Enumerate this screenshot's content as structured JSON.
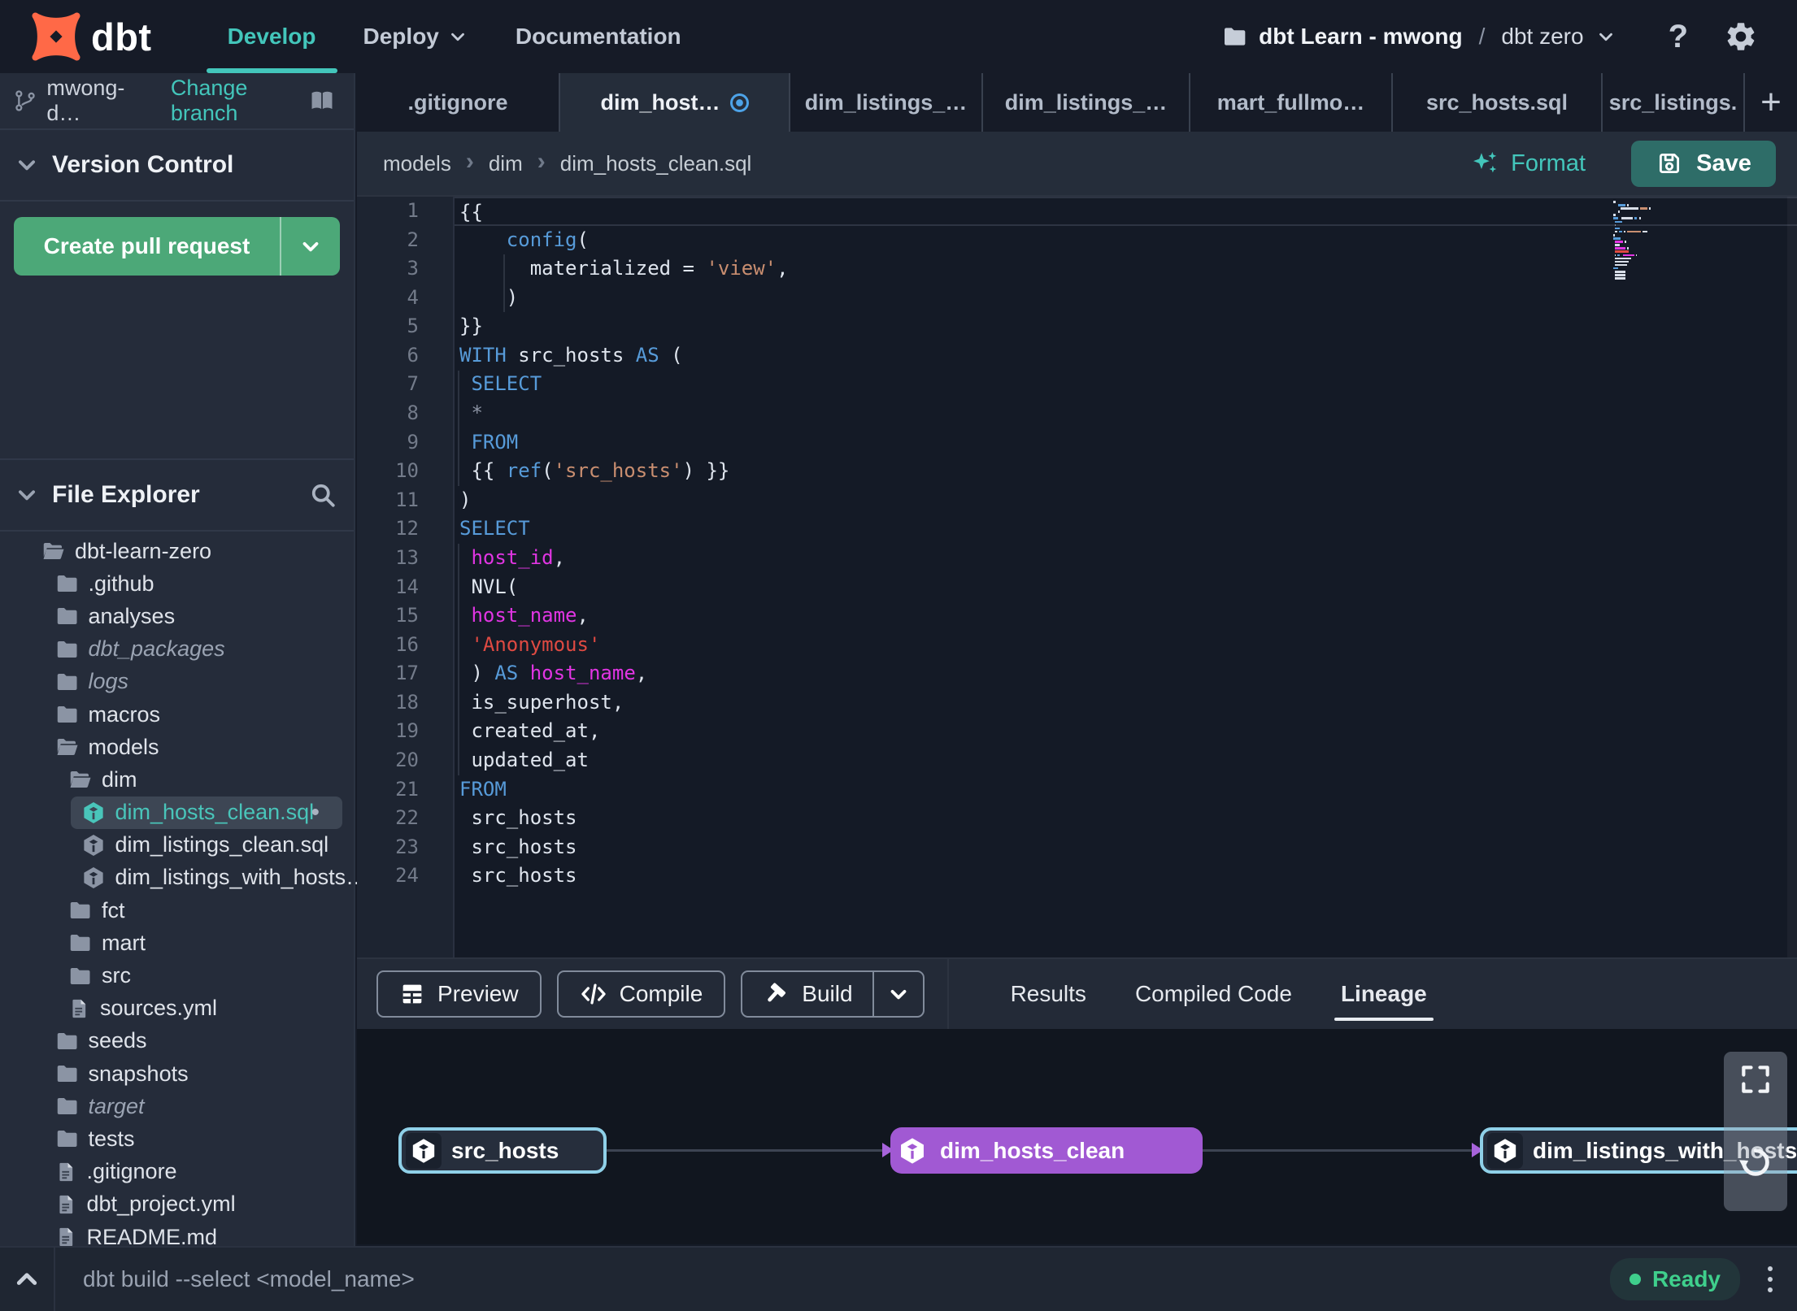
{
  "topnav": {
    "brand": "dbt",
    "nav_items": [
      {
        "label": "Develop",
        "active": true
      },
      {
        "label": "Deploy",
        "chevron": true
      },
      {
        "label": "Documentation"
      }
    ],
    "account_name": "dbt Learn - mwong",
    "path_separator": "/",
    "project_name": "dbt zero",
    "help_label": "?"
  },
  "sidebar": {
    "branch_name": "mwong-d…",
    "change_branch_label": "Change branch",
    "version_control_title": "Version Control",
    "create_pr_label": "Create pull request",
    "file_explorer_title": "File Explorer",
    "tree": [
      {
        "name": "dbt-learn-zero",
        "type": "folder-open",
        "depth": 0
      },
      {
        "name": ".github",
        "type": "folder",
        "depth": 1
      },
      {
        "name": "analyses",
        "type": "folder",
        "depth": 1
      },
      {
        "name": "dbt_packages",
        "type": "folder",
        "depth": 1,
        "italic": true
      },
      {
        "name": "logs",
        "type": "folder",
        "depth": 1,
        "italic": true
      },
      {
        "name": "macros",
        "type": "folder",
        "depth": 1
      },
      {
        "name": "models",
        "type": "folder-open",
        "depth": 1
      },
      {
        "name": "dim",
        "type": "folder-open",
        "depth": 2
      },
      {
        "name": "dim_hosts_clean.sql",
        "type": "model",
        "depth": 3,
        "selected": true,
        "modified": true
      },
      {
        "name": "dim_listings_clean.sql",
        "type": "model",
        "depth": 3
      },
      {
        "name": "dim_listings_with_hosts…",
        "type": "model",
        "depth": 3
      },
      {
        "name": "fct",
        "type": "folder",
        "depth": 2
      },
      {
        "name": "mart",
        "type": "folder",
        "depth": 2
      },
      {
        "name": "src",
        "type": "folder",
        "depth": 2
      },
      {
        "name": "sources.yml",
        "type": "file",
        "depth": 2
      },
      {
        "name": "seeds",
        "type": "folder",
        "depth": 1
      },
      {
        "name": "snapshots",
        "type": "folder",
        "depth": 1
      },
      {
        "name": "target",
        "type": "folder",
        "depth": 1,
        "italic": true
      },
      {
        "name": "tests",
        "type": "folder",
        "depth": 1
      },
      {
        "name": ".gitignore",
        "type": "file",
        "depth": 1
      },
      {
        "name": "dbt_project.yml",
        "type": "file",
        "depth": 1
      },
      {
        "name": "README.md",
        "type": "file",
        "depth": 1
      }
    ]
  },
  "tabs": [
    {
      "label": ".gitignore"
    },
    {
      "label": "dim_host…",
      "active": true,
      "unsaved": true
    },
    {
      "label": "dim_listings_…"
    },
    {
      "label": "dim_listings_…"
    },
    {
      "label": "mart_fullmo…"
    },
    {
      "label": "src_hosts.sql"
    },
    {
      "label": "src_listings."
    }
  ],
  "editor": {
    "breadcrumb": [
      "models",
      "dim",
      "dim_hosts_clean.sql"
    ],
    "format_label": "Format",
    "save_label": "Save",
    "lines": [
      {
        "n": 1,
        "cursor": true,
        "tokens": [
          [
            "w",
            "{{"
          ]
        ]
      },
      {
        "n": 2,
        "tokens": [
          [
            "w",
            "    "
          ],
          [
            "b",
            "config"
          ],
          [
            "w",
            "("
          ]
        ]
      },
      {
        "n": 3,
        "tokens": [
          [
            "w",
            "      materialized = "
          ],
          [
            "o",
            "'view'"
          ],
          [
            "w",
            ","
          ]
        ]
      },
      {
        "n": 4,
        "tokens": [
          [
            "w",
            "    )"
          ]
        ]
      },
      {
        "n": 5,
        "tokens": [
          [
            "w",
            "}}"
          ]
        ]
      },
      {
        "n": 6,
        "tokens": [
          [
            "b",
            "WITH"
          ],
          [
            "w",
            " src_hosts "
          ],
          [
            "b",
            "AS"
          ],
          [
            "w",
            " ("
          ]
        ]
      },
      {
        "n": 7,
        "tokens": [
          [
            "w",
            " "
          ],
          [
            "b",
            "SELECT"
          ]
        ]
      },
      {
        "n": 8,
        "tokens": [
          [
            "g",
            " *"
          ]
        ]
      },
      {
        "n": 9,
        "tokens": [
          [
            "w",
            " "
          ],
          [
            "b",
            "FROM"
          ]
        ]
      },
      {
        "n": 10,
        "tokens": [
          [
            "w",
            " {{ "
          ],
          [
            "b",
            "ref"
          ],
          [
            "w",
            "("
          ],
          [
            "o",
            "'src_hosts'"
          ],
          [
            "w",
            ") }}"
          ]
        ]
      },
      {
        "n": 11,
        "tokens": [
          [
            "w",
            ")"
          ]
        ]
      },
      {
        "n": 12,
        "tokens": [
          [
            "b",
            "SELECT"
          ]
        ]
      },
      {
        "n": 13,
        "tokens": [
          [
            "w",
            " "
          ],
          [
            "m",
            "host_id"
          ],
          [
            "w",
            ","
          ]
        ]
      },
      {
        "n": 14,
        "tokens": [
          [
            "w",
            " NVL("
          ]
        ]
      },
      {
        "n": 15,
        "tokens": [
          [
            "w",
            " "
          ],
          [
            "m",
            "host_name"
          ],
          [
            "w",
            ","
          ]
        ]
      },
      {
        "n": 16,
        "tokens": [
          [
            "w",
            " "
          ],
          [
            "r",
            "'Anonymous'"
          ]
        ]
      },
      {
        "n": 17,
        "tokens": [
          [
            "w",
            " ) "
          ],
          [
            "b",
            "AS"
          ],
          [
            "w",
            " "
          ],
          [
            "m",
            "host_name"
          ],
          [
            "w",
            ","
          ]
        ]
      },
      {
        "n": 18,
        "tokens": [
          [
            "w",
            " is_superhost,"
          ]
        ]
      },
      {
        "n": 19,
        "tokens": [
          [
            "w",
            " created_at,"
          ]
        ]
      },
      {
        "n": 20,
        "tokens": [
          [
            "w",
            " updated_at"
          ]
        ]
      },
      {
        "n": 21,
        "tokens": [
          [
            "b",
            "FROM"
          ]
        ]
      },
      {
        "n": 22,
        "tokens": [
          [
            "w",
            " src_hosts"
          ]
        ]
      },
      {
        "n": 23,
        "tokens": [
          [
            "w",
            " src_hosts"
          ]
        ]
      },
      {
        "n": 24,
        "tokens": [
          [
            "w",
            " src_hosts"
          ]
        ]
      }
    ]
  },
  "toolbar": {
    "preview_label": "Preview",
    "compile_label": "Compile",
    "build_label": "Build",
    "tabs": [
      {
        "label": "Results"
      },
      {
        "label": "Compiled Code"
      },
      {
        "label": "Lineage",
        "active": true
      }
    ]
  },
  "lineage": {
    "nodes": [
      {
        "label": "src_hosts",
        "kind": "source"
      },
      {
        "label": "dim_hosts_clean",
        "kind": "selected"
      },
      {
        "label": "dim_listings_with_hosts",
        "kind": "source"
      }
    ]
  },
  "command_bar": {
    "command": "dbt build --select <model_name>",
    "status_label": "Ready"
  },
  "colors": {
    "accent_teal": "#43c6bb",
    "button_green": "#4ca878",
    "node_purple": "#a159d3",
    "node_border_blue": "#8fd0e8",
    "status_green": "#3fcf8c",
    "unsaved_blue": "#4da3e8",
    "keyword_blue": "#579bd9",
    "identifier_magenta": "#e135e3",
    "string_salmon": "#c98e70",
    "string_red": "#df4a42"
  }
}
